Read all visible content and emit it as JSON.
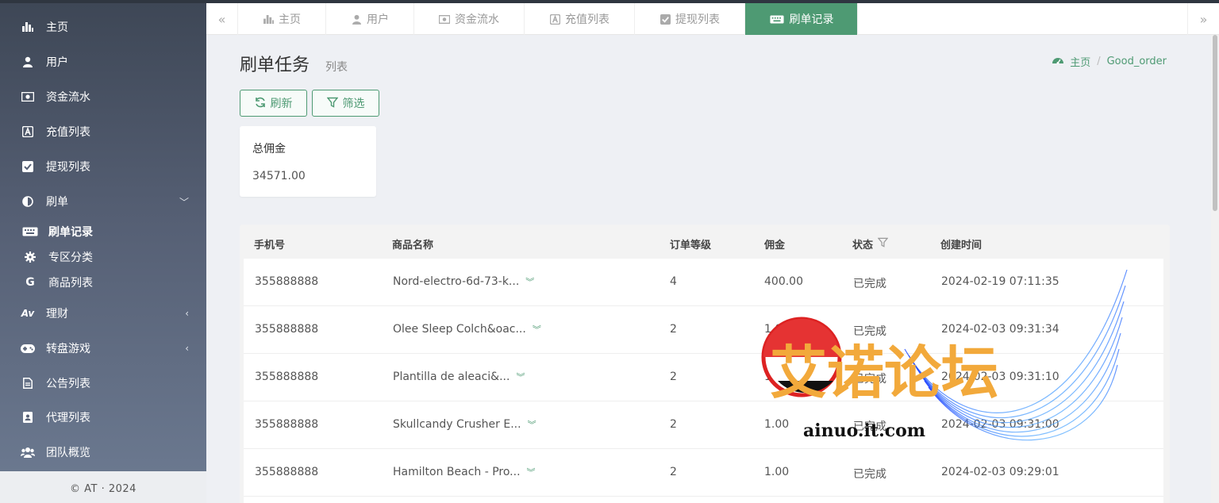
{
  "sidebar": {
    "items": [
      {
        "label": "主页",
        "icon": "bar-chart-icon"
      },
      {
        "label": "用户",
        "icon": "user-icon"
      },
      {
        "label": "资金流水",
        "icon": "money-icon"
      },
      {
        "label": "充值列表",
        "icon": "font-icon"
      },
      {
        "label": "提现列表",
        "icon": "check-square-icon"
      },
      {
        "label": "刷单",
        "icon": "adjust-icon",
        "chevron": "﹀"
      },
      {
        "label": "理财",
        "icon": "aviato-icon",
        "chevron": "‹"
      },
      {
        "label": "转盘游戏",
        "icon": "gamepad-icon",
        "chevron": "‹"
      },
      {
        "label": "公告列表",
        "icon": "file-text-icon"
      },
      {
        "label": "代理列表",
        "icon": "address-book-icon"
      },
      {
        "label": "团队概览",
        "icon": "users-icon"
      }
    ],
    "subitems": [
      {
        "label": "刷单记录",
        "icon": "keyboard-icon"
      },
      {
        "label": "专区分类",
        "icon": "cog-icon"
      },
      {
        "label": "商品列表",
        "icon": "google-icon"
      }
    ],
    "footer": "© AT · 2024"
  },
  "tabs": {
    "prev": "«",
    "next": "»",
    "items": [
      {
        "label": "主页"
      },
      {
        "label": "用户"
      },
      {
        "label": "资金流水"
      },
      {
        "label": "充值列表"
      },
      {
        "label": "提现列表"
      },
      {
        "label": "刷单记录"
      }
    ]
  },
  "page": {
    "title": "刷单任务",
    "subtitle": "列表",
    "breadcrumb_home": "主页",
    "breadcrumb_sep": "/",
    "breadcrumb_current": "Good_order",
    "refresh_label": "刷新",
    "filter_label": "筛选"
  },
  "summary": {
    "title": "总佣金",
    "value": "34571.00"
  },
  "table": {
    "headers": [
      "手机号",
      "商品名称",
      "订单等级",
      "佣金",
      "状态",
      "创建时间"
    ],
    "rows": [
      {
        "phone": "355888888",
        "name": "Nord-electro-6d-73-k...",
        "level": "4",
        "commission": "400.00",
        "status": "已完成",
        "created": "2024-02-19 07:11:35"
      },
      {
        "phone": "355888888",
        "name": "Olee Sleep Colch&oac...",
        "level": "2",
        "commission": "1.00",
        "status": "已完成",
        "created": "2024-02-03 09:31:34"
      },
      {
        "phone": "355888888",
        "name": "Plantilla de aleaci&...",
        "level": "2",
        "commission": "1.00",
        "status": "已完成",
        "created": "2024-02-03 09:31:10"
      },
      {
        "phone": "355888888",
        "name": "Skullcandy Crusher E...",
        "level": "2",
        "commission": "1.00",
        "status": "已完成",
        "created": "2024-02-03 09:31:00"
      },
      {
        "phone": "355888888",
        "name": "Hamilton Beach - Pro...",
        "level": "2",
        "commission": "1.00",
        "status": "已完成",
        "created": "2024-02-03 09:29:01"
      }
    ],
    "expand_glyph": "︾"
  },
  "watermark": {
    "text": "艾诺论坛",
    "domain": "ainuo.it.com"
  },
  "colors": {
    "accent": "#4e9a73",
    "sidebar_top": "#3e4756",
    "sidebar_bottom": "#6d7b92"
  }
}
